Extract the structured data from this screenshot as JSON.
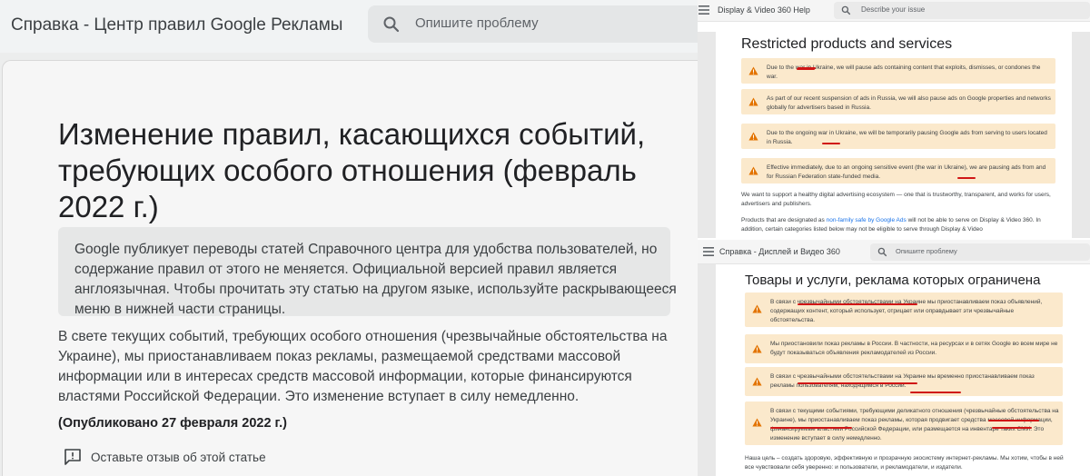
{
  "left": {
    "header_title": "Справка - Центр правил Google Рекламы",
    "search_placeholder": "Опишите проблему",
    "heading": "Изменение правил, касающихся событий, требующих особого отношения (февраль 2022 г.)",
    "note": "Google публикует переводы статей Справочного центра для удобства пользователей, но содержание правил от этого не меняется. Официальной версией правил является англоязычная. Чтобы прочитать эту статью на другом языке, используйте раскрывающееся меню в нижней части страницы.",
    "body": "В свете текущих событий, требующих особого отношения (чрезвычайные обстоятельства на Украине), мы приостанавливаем показ рекламы, размещаемой средствами массовой информации или в интересах средств массовой информации, которые финансируются властями Российской Федерации. Это изменение вступает в силу немедленно.",
    "published": "(Опубликовано 27 февраля 2022 г.)",
    "feedback": "Оставьте отзыв об этой статье"
  },
  "right_top": {
    "header_title": "Display & Video 360 Help",
    "search_placeholder": "Describe your issue",
    "heading": "Restricted products and services",
    "warnings": [
      "Due to the war in Ukraine, we will pause ads containing content that exploits, dismisses, or condones the war.",
      "As part of our recent suspension of ads in Russia, we will also pause ads on Google properties and networks globally for advertisers based in Russia.",
      "Due to the ongoing war in Ukraine, we will be temporarily pausing Google ads from serving to users located in Russia.",
      "Effective immediately, due to an ongoing sensitive event (the war in Ukraine), we are pausing ads from and for Russian Federation state-funded media."
    ],
    "para1": "We want to support a healthy digital advertising ecosystem — one that is trustworthy, transparent, and works for users, advertisers and publishers.",
    "para2_before": "Products that are designated as ",
    "para2_link": "non-family safe by Google Ads",
    "para2_after": " will not be able to serve on Display & Video 360. In addition, certain categories listed below may not be eligible to serve through Display & Video"
  },
  "right_bottom": {
    "header_title": "Справка - Дисплей и Видео 360",
    "search_placeholder": "Опишите проблему",
    "heading": "Товары и услуги, реклама которых ограничена",
    "warnings": [
      "В связи с чрезвычайными обстоятельствами на Украине мы приостанавливаем показ объявлений, содержащих контент, который использует, отрицает или оправдывает эти чрезвычайные обстоятельства.",
      "Мы приостановили показ рекламы в России. В частности, на ресурсах и в сетях Google во всем мире не будут показываться объявления рекламодателей из России.",
      "В связи с чрезвычайными обстоятельствами на Украине мы временно приостанавливаем показ рекламы пользователям, находящимся в России.",
      "В связи с текущими событиями, требующими деликатного отношения (чрезвычайные обстоятельства на Украине), мы приостанавливаем показ рекламы, которая продвигает средства массовой информации, финансируемые властями Российской Федерации, или размещается на инвентаре таких СМИ. Это изменение вступает в силу немедленно."
    ],
    "para1": "Наша цель – создать здоровую, эффективную и прозрачную экосистему интернет-рекламы. Мы хотим, чтобы в ней все чувствовали себя уверенно: и пользователи, и рекламодатели, и издатели."
  },
  "colors": {
    "warning_bg": "#fbe9cc",
    "warning_icon": "#e37400",
    "highlight_underline": "#d01616",
    "link": "#1a73e8"
  },
  "icons": [
    "search-icon",
    "menu-icon",
    "warning-icon",
    "feedback-icon"
  ]
}
